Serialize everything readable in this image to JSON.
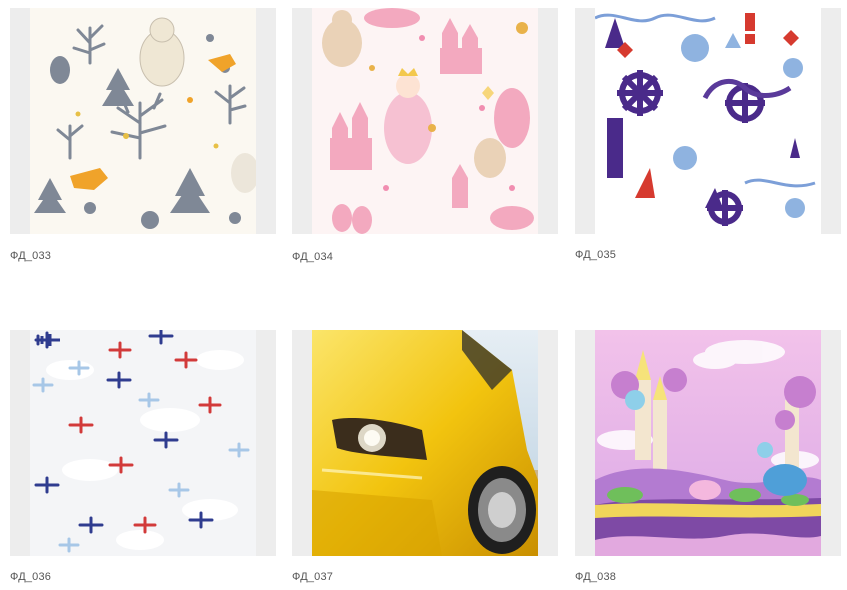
{
  "products": [
    {
      "code": "ФД_033",
      "image": "forest-animals-pattern"
    },
    {
      "code": "ФД_034",
      "image": "princess-castle-pattern"
    },
    {
      "code": "ФД_035",
      "image": "nautical-pattern"
    },
    {
      "code": "ФД_036",
      "image": "airplanes-clouds-pattern"
    },
    {
      "code": "ФД_037",
      "image": "yellow-sports-car-photo"
    },
    {
      "code": "ФД_038",
      "image": "fairytale-candy-castle-landscape"
    }
  ],
  "colors": {
    "thumb_bg": "#ededed",
    "caption": "#555555"
  }
}
